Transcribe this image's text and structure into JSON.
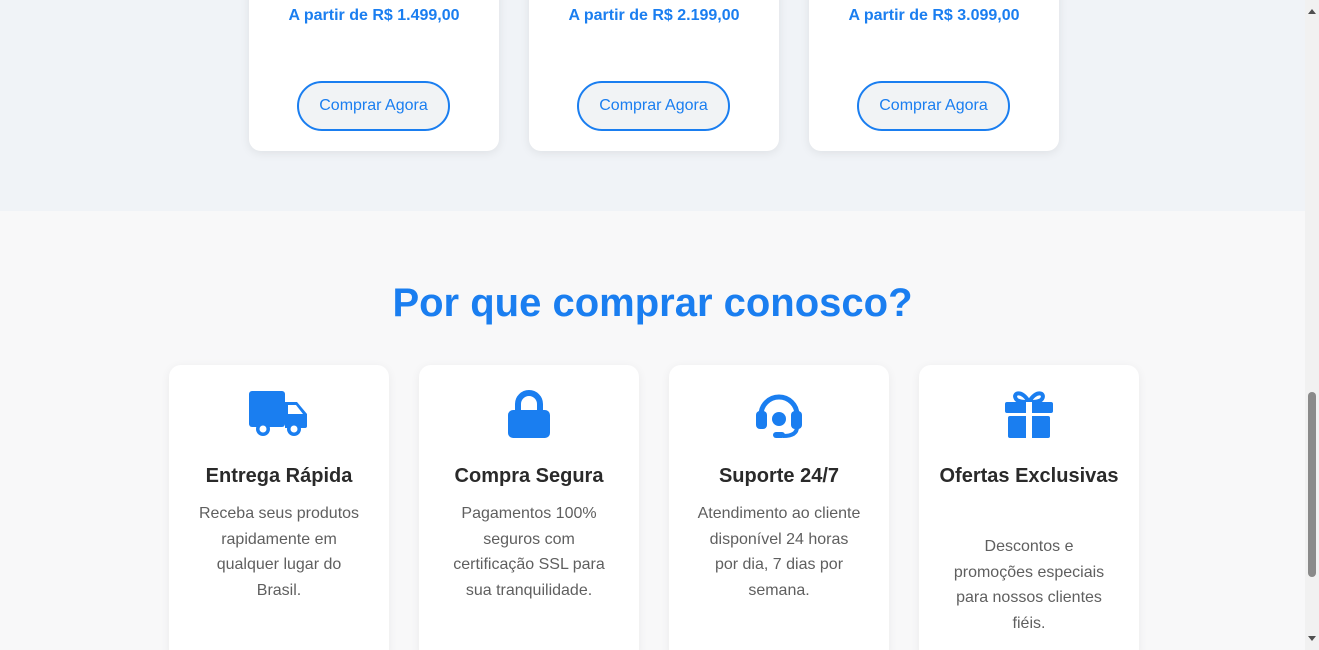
{
  "products": [
    {
      "price": "A partir de R$ 1.499,00",
      "button": "Comprar Agora"
    },
    {
      "price": "A partir de R$ 2.199,00",
      "button": "Comprar Agora"
    },
    {
      "price": "A partir de R$ 3.099,00",
      "button": "Comprar Agora"
    }
  ],
  "why": {
    "title": "Por que comprar conosco?",
    "features": [
      {
        "icon": "truck-icon",
        "title": "Entrega Rápida",
        "desc": "Receba seus produtos rapidamente em qualquer lugar do Brasil."
      },
      {
        "icon": "lock-icon",
        "title": "Compra Segura",
        "desc": "Pagamentos 100% seguros com certificação SSL para sua tranquilidade."
      },
      {
        "icon": "headset-icon",
        "title": "Suporte 24/7",
        "desc": "Atendimento ao cliente disponível 24 horas por dia, 7 dias por semana."
      },
      {
        "icon": "gift-icon",
        "title": "Ofertas Exclusivas",
        "desc": "Descontos e promoções especiais para nossos clientes fiéis."
      }
    ]
  },
  "colors": {
    "accent": "#1a7ef0",
    "text_dark": "#2a2a2a",
    "text_muted": "#5f5f5f"
  }
}
